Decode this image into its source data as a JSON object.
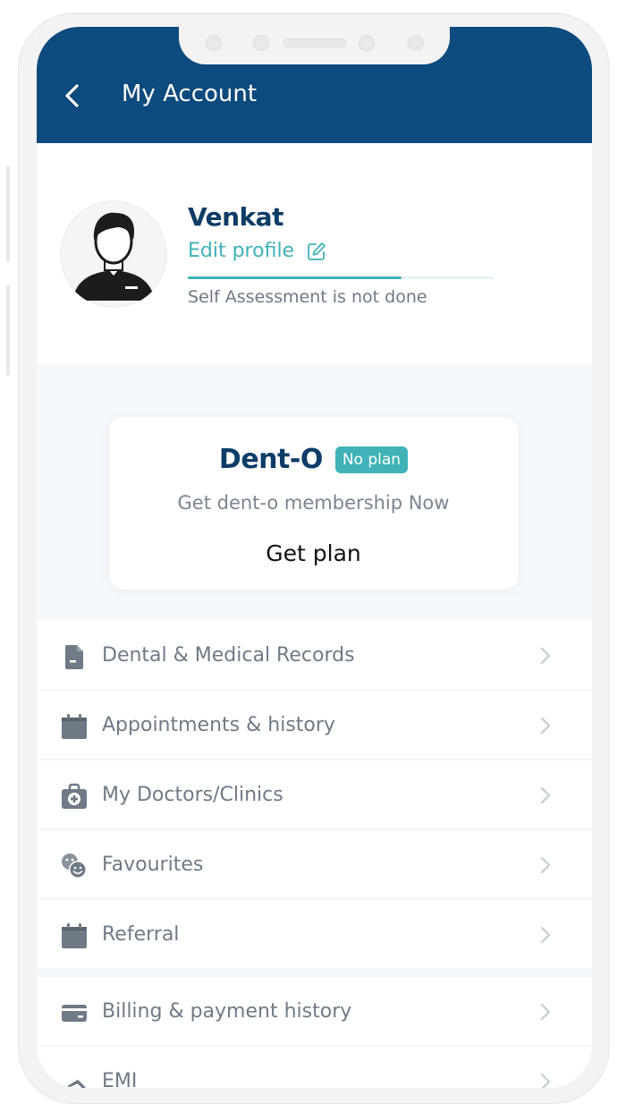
{
  "header": {
    "title": "My Account",
    "back_icon": "chevron-left-icon"
  },
  "profile": {
    "name": "Venkat",
    "edit_label": "Edit profile",
    "edit_icon": "edit-icon",
    "progress": 0.7,
    "assessment_status": "Self Assessment is not done"
  },
  "plan": {
    "name": "Dent-O",
    "badge": "No plan",
    "description": "Get dent-o membership Now",
    "cta": "Get plan"
  },
  "menu": {
    "items": [
      {
        "label": "Dental & Medical Records",
        "icon": "document-icon"
      },
      {
        "label": "Appointments & history",
        "icon": "calendar-icon"
      },
      {
        "label": "My Doctors/Clinics",
        "icon": "medical-bag-icon"
      },
      {
        "label": "Favourites",
        "icon": "favourites-icon"
      },
      {
        "label": "Referral",
        "icon": "calendar-icon"
      },
      {
        "label": "Billing & payment history",
        "icon": "credit-card-icon"
      },
      {
        "label": "EMI",
        "icon": "emi-icon"
      }
    ]
  },
  "colors": {
    "header_bg": "#0d4a7d",
    "accent": "#3fb3b7",
    "name_text": "#0d3c66",
    "menu_text": "#6f7a86"
  }
}
